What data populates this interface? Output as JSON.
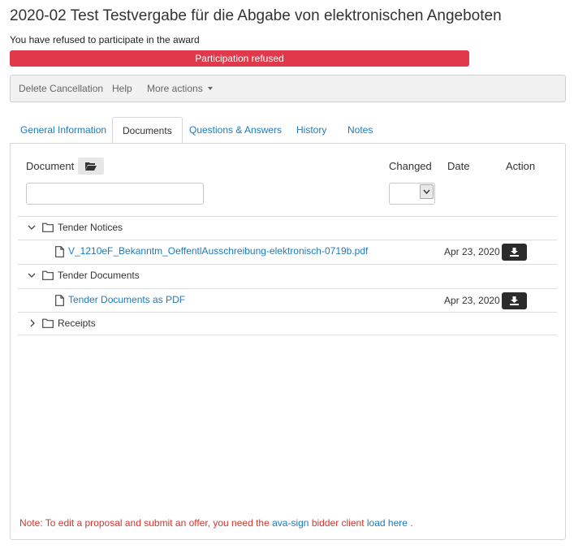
{
  "page": {
    "title": "2020-02 Test Testvergabe für die Abgabe von elektronischen Angeboten",
    "status_text": "You have refused to participate in the award",
    "status_badge": "Participation refused",
    "status_color": "#e0394a"
  },
  "toolbar": {
    "delete_cancellation": "Delete Cancellation",
    "help": "Help",
    "more_actions": "More actions"
  },
  "tabs": [
    {
      "label": "General Information",
      "active": false
    },
    {
      "label": "Documents",
      "active": true
    },
    {
      "label": "Questions & Answers",
      "active": false
    },
    {
      "label": "History",
      "active": false
    },
    {
      "label": "Notes",
      "active": false
    }
  ],
  "table": {
    "headers": {
      "document": "Document",
      "changed": "Changed",
      "date": "Date",
      "action": "Action"
    },
    "filter_value": "",
    "changed_selected": ""
  },
  "tree": {
    "folder1": {
      "name": "Tender Notices",
      "expanded": true,
      "icon": "chevron-down-icon"
    },
    "file1": {
      "name": "V_1210eF_Bekanntm_OeffentlAusschreibung-elektronisch-0719b.pdf",
      "date": "Apr 23, 2020",
      "icon": "download-icon"
    },
    "folder2": {
      "name": "Tender Documents",
      "expanded": true,
      "icon": "chevron-down-icon"
    },
    "file2": {
      "name": "Tender Documents as PDF",
      "date": "Apr 23, 2020",
      "icon": "download-icon"
    },
    "folder3": {
      "name": "Receipts",
      "expanded": false,
      "icon": "chevron-right-icon"
    }
  },
  "note": {
    "prefix": "Note: To edit a proposal and submit an offer, you need the",
    "link1": "ava-sign",
    "middle": "bidder client",
    "link2": "load here",
    "suffix": "."
  },
  "colors": {
    "link": "#1a7bbf",
    "note": "#d9342b",
    "download_button": "#2b2b2b"
  }
}
